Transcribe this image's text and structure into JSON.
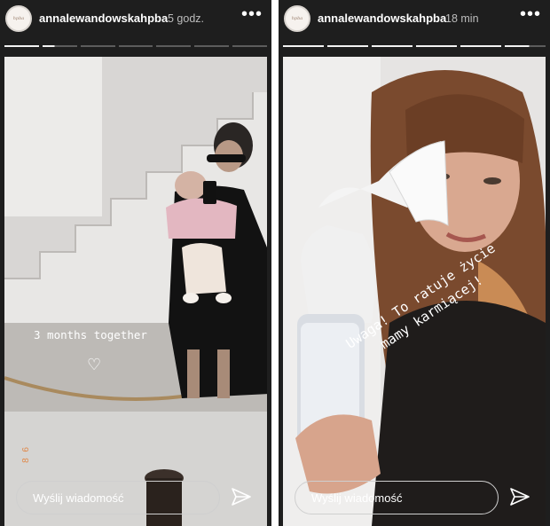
{
  "stories": [
    {
      "username": "annalewandowskahpba",
      "time": "5 godz.",
      "avatar_text": "healthyplanbyann",
      "progress": [
        1,
        0.35,
        0,
        0,
        0,
        0,
        0
      ],
      "caption": "3 months together",
      "heart": "♡",
      "side_text": "8 6",
      "reply_placeholder": "Wyślij wiadomość"
    },
    {
      "username": "annalewandowskahpba",
      "time": "18 min",
      "avatar_text": "healthyplanbyann",
      "progress": [
        1,
        1,
        1,
        1,
        1,
        0.6
      ],
      "caption_line1": "Uwaga! To ratuje życie",
      "caption_line2": "mamy karmiącej!",
      "reply_placeholder": "Wyślij wiadomość"
    }
  ],
  "colors": {
    "bg": "#1e1e1e",
    "accent_text": "#e08a4c"
  }
}
